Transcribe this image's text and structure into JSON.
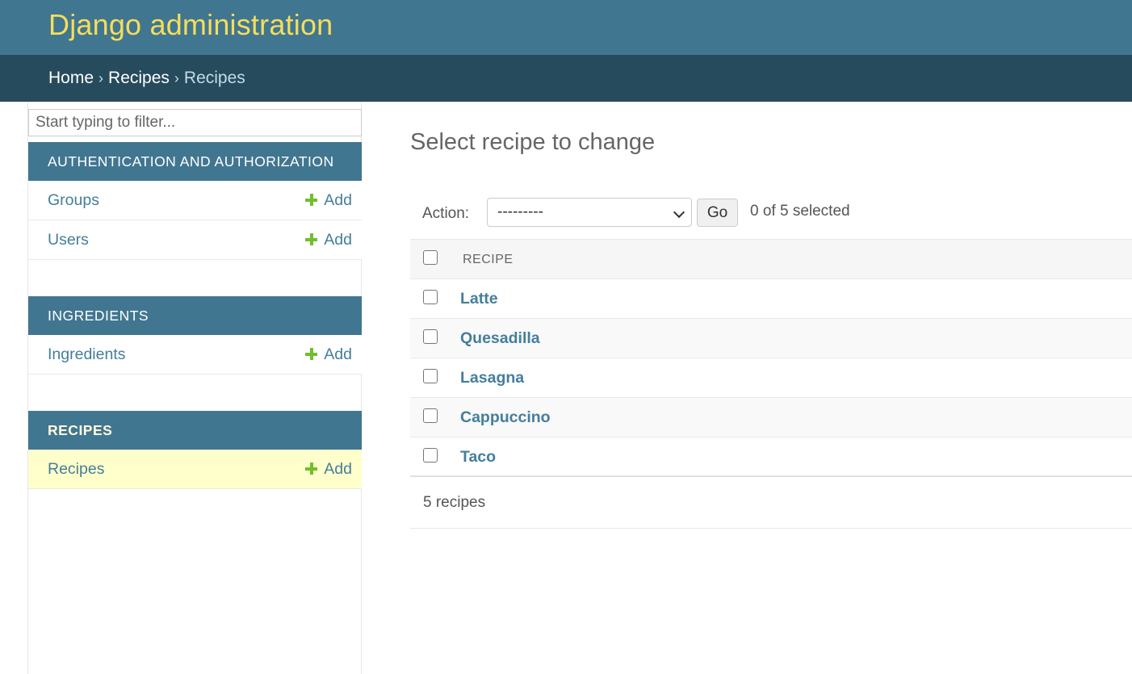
{
  "header": {
    "title": "Django administration"
  },
  "breadcrumbs": [
    "Home",
    "Recipes",
    "Recipes"
  ],
  "sidebar": {
    "filter_placeholder": "Start typing to filter...",
    "modules": [
      {
        "caption": "AUTHENTICATION AND AUTHORIZATION",
        "models": [
          {
            "name": "Groups",
            "add": "Add"
          },
          {
            "name": "Users",
            "add": "Add"
          }
        ]
      },
      {
        "caption": "INGREDIENTS",
        "models": [
          {
            "name": "Ingredients",
            "add": "Add"
          }
        ]
      },
      {
        "caption": "RECIPES",
        "models": [
          {
            "name": "Recipes",
            "add": "Add"
          }
        ]
      }
    ]
  },
  "content": {
    "title": "Select recipe to change",
    "action_label": "Action:",
    "action_selected": "---------",
    "go_label": "Go",
    "selected_text": "0 of 5 selected",
    "column_header": "RECIPE",
    "rows": [
      "Latte",
      "Quesadilla",
      "Lasagna",
      "Cappuccino",
      "Taco"
    ],
    "paginator": "5 recipes"
  },
  "colors": {
    "header_bg": "#417690",
    "breadcrumb_bg": "#264b5d",
    "brand_text": "#f5dd5d",
    "link": "#447e9b",
    "add_icon": "#70bf2b",
    "current_row": "#ffffcc"
  }
}
